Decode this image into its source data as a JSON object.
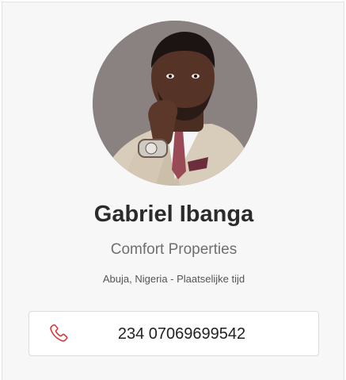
{
  "profile": {
    "name": "Gabriel Ibanga",
    "company": "Comfort Properties",
    "location": "Abuja, Nigeria - Plaatselijke tijd",
    "avatar_icon": "profile-photo"
  },
  "contact": {
    "phone": "234 07069699542",
    "phone_icon": "phone-icon",
    "icon_color": "#d9393b"
  }
}
